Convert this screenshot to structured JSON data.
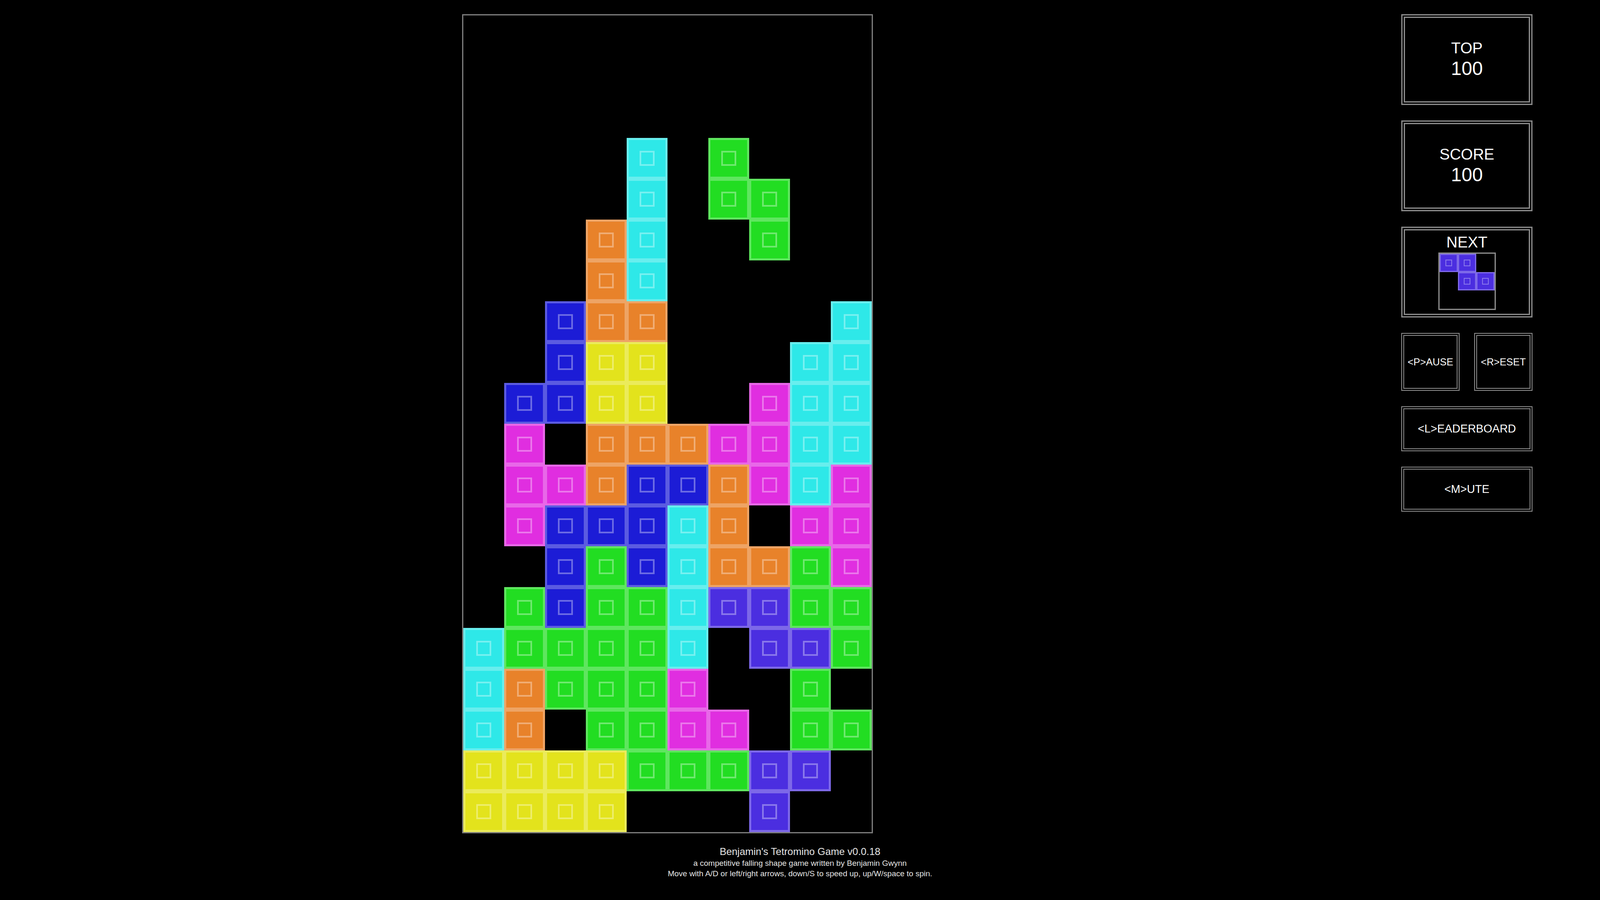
{
  "board": {
    "rows": [
      [
        null,
        null,
        null,
        null,
        null,
        null,
        null,
        null,
        null,
        null
      ],
      [
        null,
        null,
        null,
        null,
        null,
        null,
        null,
        null,
        null,
        null
      ],
      [
        null,
        null,
        null,
        null,
        null,
        null,
        null,
        null,
        null,
        null
      ],
      [
        null,
        null,
        null,
        null,
        "#2ee8e8",
        null,
        "#22dd22",
        null,
        null,
        null
      ],
      [
        null,
        null,
        null,
        null,
        "#2ee8e8",
        null,
        "#22dd22",
        "#22dd22",
        null,
        null
      ],
      [
        null,
        null,
        null,
        "#e8822a",
        "#2ee8e8",
        null,
        null,
        "#22dd22",
        null,
        null
      ],
      [
        null,
        null,
        null,
        "#e8822a",
        "#2ee8e8",
        null,
        null,
        null,
        null,
        null
      ],
      [
        null,
        null,
        "#1c1cd6",
        "#e8822a",
        "#e8822a",
        null,
        null,
        null,
        null,
        "#2ee8e8"
      ],
      [
        null,
        null,
        "#1c1cd6",
        "#e3e31c",
        "#e3e31c",
        null,
        null,
        null,
        "#2ee8e8",
        "#2ee8e8"
      ],
      [
        null,
        "#1c1cd6",
        "#1c1cd6",
        "#e3e31c",
        "#e3e31c",
        null,
        null,
        "#e02ee0",
        "#2ee8e8",
        "#2ee8e8"
      ],
      [
        null,
        "#e02ee0",
        null,
        "#e8822a",
        "#e8822a",
        "#e8822a",
        "#e02ee0",
        "#e02ee0",
        "#2ee8e8",
        "#2ee8e8"
      ],
      [
        null,
        "#e02ee0",
        "#e02ee0",
        "#e8822a",
        "#1c1cd6",
        "#1c1cd6",
        "#e8822a",
        "#e02ee0",
        "#2ee8e8",
        "#e02ee0"
      ],
      [
        null,
        "#e02ee0",
        "#1c1cd6",
        "#1c1cd6",
        "#1c1cd6",
        "#2ee8e8",
        "#e8822a",
        null,
        "#e02ee0",
        "#e02ee0"
      ],
      [
        null,
        null,
        "#1c1cd6",
        "#22dd22",
        "#1c1cd6",
        "#2ee8e8",
        "#e8822a",
        "#e8822a",
        "#22dd22",
        "#e02ee0"
      ],
      [
        null,
        "#22dd22",
        "#1c1cd6",
        "#22dd22",
        "#22dd22",
        "#2ee8e8",
        "#4b2ee0",
        "#4b2ee0",
        "#22dd22",
        "#22dd22"
      ],
      [
        "#2ee8e8",
        "#22dd22",
        "#22dd22",
        "#22dd22",
        "#22dd22",
        "#2ee8e8",
        null,
        "#4b2ee0",
        "#4b2ee0",
        "#22dd22"
      ],
      [
        "#2ee8e8",
        "#e8822a",
        "#22dd22",
        "#22dd22",
        "#22dd22",
        "#e02ee0",
        null,
        null,
        "#22dd22",
        null
      ],
      [
        "#2ee8e8",
        "#e8822a",
        null,
        "#22dd22",
        "#22dd22",
        "#e02ee0",
        "#e02ee0",
        null,
        "#22dd22",
        "#22dd22"
      ],
      [
        "#e3e31c",
        "#e3e31c",
        "#e3e31c",
        "#e3e31c",
        "#22dd22",
        "#22dd22",
        "#22dd22",
        "#4b2ee0",
        "#4b2ee0",
        null
      ],
      [
        "#e3e31c",
        "#e3e31c",
        "#e3e31c",
        "#e3e31c",
        null,
        null,
        null,
        "#4b2ee0",
        null,
        null
      ]
    ]
  },
  "stats": [
    {
      "label": "TOP",
      "value": "100"
    },
    {
      "label": "SCORE",
      "value": "100"
    }
  ],
  "next": {
    "label": "NEXT",
    "cells": [
      [
        "#4b2ee0",
        "#4b2ee0",
        null
      ],
      [
        null,
        "#4b2ee0",
        "#4b2ee0"
      ],
      [
        null,
        null,
        null
      ]
    ]
  },
  "controls": {
    "pair": [
      "<P>AUSE",
      "<R>ESET"
    ],
    "wide": [
      "<L>EADERBOARD",
      "<M>UTE"
    ]
  },
  "footer": {
    "title": "Benjamin's Tetromino Game v0.0.18",
    "subtitle": "a competitive falling shape game written by Benjamin Gwynn",
    "help": "Move with A/D or left/right arrows, down/S to speed up, up/W/space to spin."
  }
}
